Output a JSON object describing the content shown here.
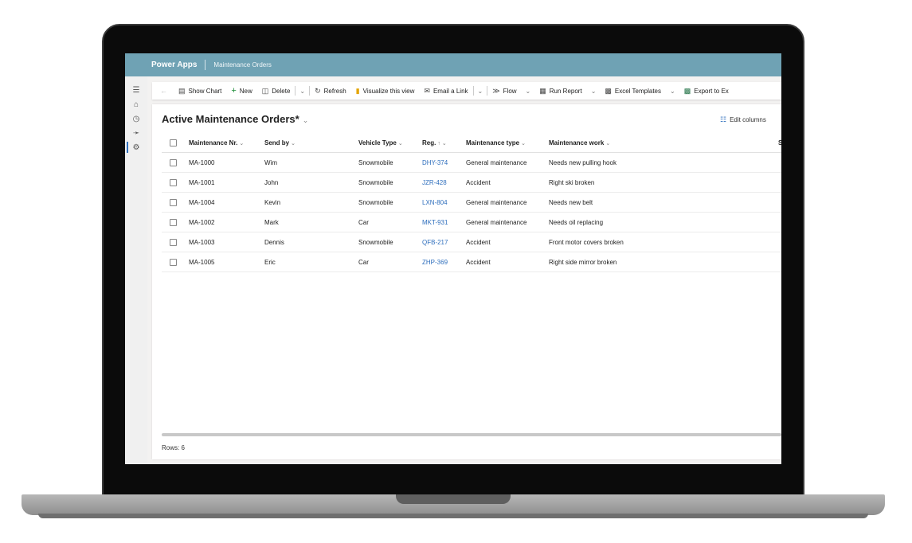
{
  "topbar": {
    "app_name": "Power Apps",
    "page_name": "Maintenance Orders"
  },
  "rail": {
    "items": [
      "menu-icon",
      "home-icon",
      "recent-icon",
      "pin-icon",
      "entity-icon"
    ]
  },
  "commands": {
    "show_chart": "Show Chart",
    "new": "New",
    "delete": "Delete",
    "refresh": "Refresh",
    "visualize": "Visualize this view",
    "email_link": "Email a Link",
    "flow": "Flow",
    "run_report": "Run Report",
    "excel_templates": "Excel Templates",
    "export": "Export to Ex"
  },
  "view": {
    "title": "Active Maintenance Orders*",
    "edit_columns": "Edit columns"
  },
  "columns": {
    "nr": "Maintenance Nr.",
    "send_by": "Send by",
    "vehicle_type": "Vehicle Type",
    "reg": "Reg.",
    "maint_type": "Maintenance type",
    "maint_work": "Maintenance work",
    "cut": "S"
  },
  "rows": [
    {
      "nr": "MA-1000",
      "send_by": "Wim",
      "vehicle_type": "Snowmobile",
      "reg": "DHY-374",
      "maint_type": "General maintenance",
      "maint_work": "Needs new pulling hook"
    },
    {
      "nr": "MA-1001",
      "send_by": "John",
      "vehicle_type": "Snowmobile",
      "reg": "JZR-428",
      "maint_type": "Accident",
      "maint_work": "Right ski broken"
    },
    {
      "nr": "MA-1004",
      "send_by": "Kevin",
      "vehicle_type": "Snowmobile",
      "reg": "LXN-804",
      "maint_type": "General maintenance",
      "maint_work": "Needs new belt"
    },
    {
      "nr": "MA-1002",
      "send_by": "Mark",
      "vehicle_type": "Car",
      "reg": "MKT-931",
      "maint_type": "General maintenance",
      "maint_work": "Needs oil replacing"
    },
    {
      "nr": "MA-1003",
      "send_by": "Dennis",
      "vehicle_type": "Snowmobile",
      "reg": "QFB-217",
      "maint_type": "Accident",
      "maint_work": "Front motor covers broken"
    },
    {
      "nr": "MA-1005",
      "send_by": "Eric",
      "vehicle_type": "Car",
      "reg": "ZHP-369",
      "maint_type": "Accident",
      "maint_work": "Right side mirror broken"
    }
  ],
  "footer": {
    "rows_label": "Rows: 6"
  },
  "colors": {
    "topbar": "#6fa2b4",
    "link": "#2f6fbd",
    "accent": "#2f6fbd"
  }
}
